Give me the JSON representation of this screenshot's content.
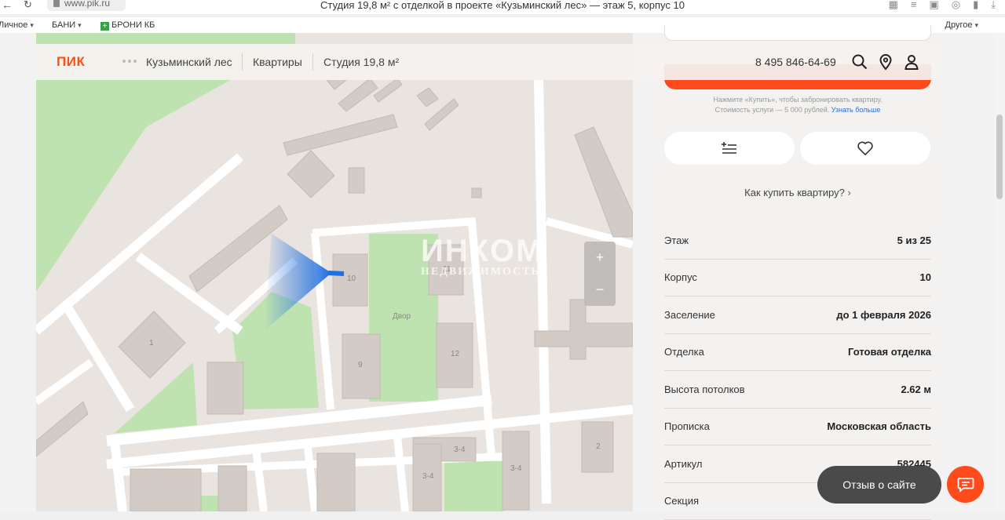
{
  "browser": {
    "url": "www.pik.ru",
    "tab_title": "Студия 19,8 м² с отделкой в проекте «Кузьминский лес» — этаж 5, корпус 10",
    "bookmarks": [
      {
        "label": "Личное",
        "has_caret": true
      },
      {
        "label": "БАНИ",
        "has_caret": true
      },
      {
        "label": "БРОНИ КБ",
        "has_caret": false
      },
      {
        "label": "Другое",
        "has_caret": true
      }
    ]
  },
  "header": {
    "logo": "ПИК",
    "breadcrumbs": [
      "Кузьминский лес",
      "Квартиры",
      "Студия 19,8 м²"
    ],
    "phone": "8 495 846-64-69"
  },
  "map": {
    "labels": {
      "b10": "10",
      "b9": "9",
      "b11": "11",
      "b12": "12",
      "b1": "1",
      "b2": "2",
      "b34a": "3-4",
      "b34b": "3-4",
      "b34c": "3-4",
      "yard": "Двор"
    },
    "zoom_in": "+",
    "zoom_out": "−",
    "watermark_main": "ИНКОМ",
    "watermark_sub": "НЕДВИЖИМОСТЬ",
    "colors": {
      "bg": "#e9e4df",
      "green": "#bfe3b0",
      "building": "#d3cbc6",
      "road": "#ffffff",
      "marker": "#1f6fe0"
    }
  },
  "panel": {
    "note_line1": "Нажмите «Купить», чтобы забронировать квартиру.",
    "note_line2": "Стоимость услуги — 5 000 рублей.",
    "note_link": "Узнать больше",
    "how_to_buy": "Как купить квартиру?",
    "specs": [
      {
        "label": "Этаж",
        "value": "5 из 25"
      },
      {
        "label": "Корпус",
        "value": "10"
      },
      {
        "label": "Заселение",
        "value": "до 1 февраля 2026"
      },
      {
        "label": "Отделка",
        "value": "Готовая отделка"
      },
      {
        "label": "Высота потолков",
        "value": "2.62 м"
      },
      {
        "label": "Прописка",
        "value": "Московская область"
      },
      {
        "label": "Артикул",
        "value": "582445"
      },
      {
        "label": "Секция",
        "value": ""
      }
    ],
    "accent": "#ff4a1c"
  },
  "floating": {
    "feedback": "Отзыв о сайте"
  }
}
